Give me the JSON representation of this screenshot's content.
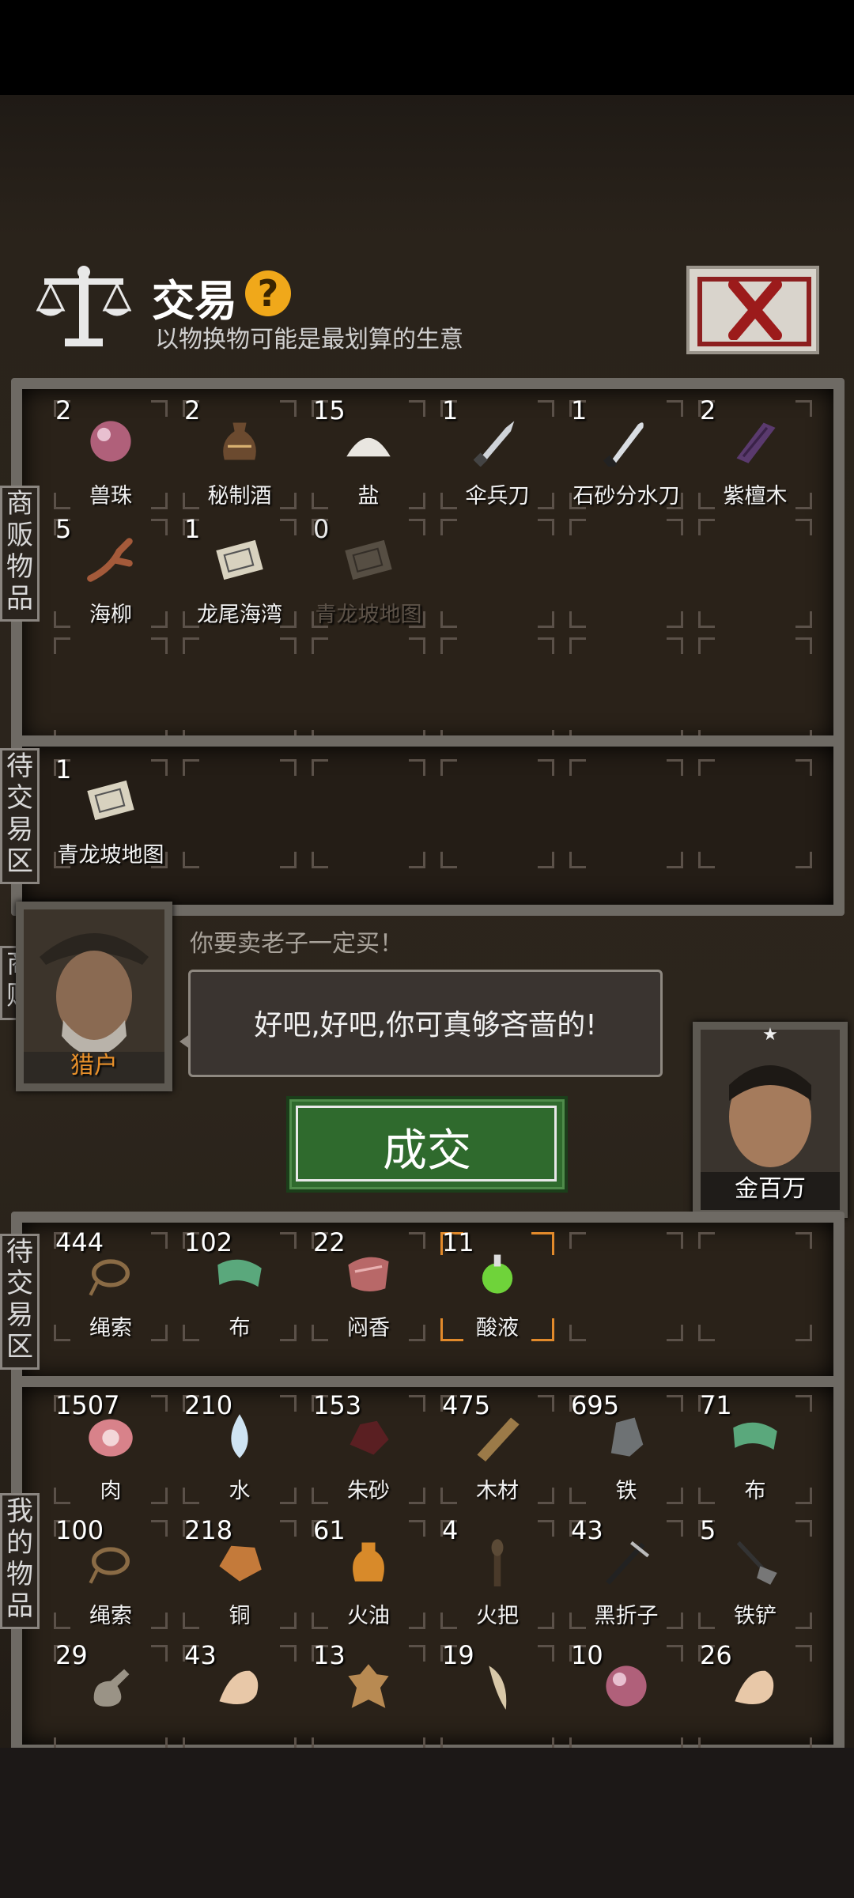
{
  "header": {
    "title": "交易",
    "subtitle": "以物换物可能是最划算的生意",
    "help_icon": "?"
  },
  "merchant_panel": {
    "side_label": "商贩物品",
    "items": [
      {
        "qty": "2",
        "name": "兽珠",
        "icon": "pearl-icon"
      },
      {
        "qty": "2",
        "name": "秘制酒",
        "icon": "wine-jar-icon"
      },
      {
        "qty": "15",
        "name": "盐",
        "icon": "salt-icon"
      },
      {
        "qty": "1",
        "name": "伞兵刀",
        "icon": "knife-icon"
      },
      {
        "qty": "1",
        "name": "石砂分水刀",
        "icon": "blade-icon"
      },
      {
        "qty": "2",
        "name": "紫檀木",
        "icon": "wood-icon"
      },
      {
        "qty": "5",
        "name": "海柳",
        "icon": "branch-icon"
      },
      {
        "qty": "1",
        "name": "龙尾海湾",
        "icon": "map-icon"
      },
      {
        "qty": "0",
        "name": "青龙坡地图",
        "icon": "map-icon"
      }
    ]
  },
  "merchant_pending": {
    "side_label": "待交易区",
    "items": [
      {
        "qty": "1",
        "name": "青龙坡地图",
        "icon": "map-icon"
      }
    ]
  },
  "dialogue": {
    "side_label": "商贩",
    "merchant_name": "猎户",
    "merchant_line": "你要卖老子一定买！",
    "bubble": "好吧,好吧,你可真够吝啬的!",
    "player_name": "金百万",
    "deal_button": "成交"
  },
  "player_pending": {
    "side_label": "待交易区",
    "items": [
      {
        "qty": "444",
        "name": "绳索",
        "icon": "rope-icon"
      },
      {
        "qty": "102",
        "name": "布",
        "icon": "cloth-icon"
      },
      {
        "qty": "22",
        "name": "闷香",
        "icon": "incense-icon"
      },
      {
        "qty": "11",
        "name": "酸液",
        "icon": "potion-icon"
      }
    ]
  },
  "player_items": {
    "side_label": "我的物品",
    "items": [
      {
        "qty": "1507",
        "name": "肉",
        "icon": "meat-icon"
      },
      {
        "qty": "210",
        "name": "水",
        "icon": "water-icon"
      },
      {
        "qty": "153",
        "name": "朱砂",
        "icon": "cinnabar-icon"
      },
      {
        "qty": "475",
        "name": "木材",
        "icon": "plank-icon"
      },
      {
        "qty": "695",
        "name": "铁",
        "icon": "iron-icon"
      },
      {
        "qty": "71",
        "name": "布",
        "icon": "cloth-icon"
      },
      {
        "qty": "100",
        "name": "绳索",
        "icon": "rope-icon"
      },
      {
        "qty": "218",
        "name": "铜",
        "icon": "copper-icon"
      },
      {
        "qty": "61",
        "name": "火油",
        "icon": "oil-icon"
      },
      {
        "qty": "4",
        "name": "火把",
        "icon": "torch-icon"
      },
      {
        "qty": "43",
        "name": "黑折子",
        "icon": "pick-icon"
      },
      {
        "qty": "5",
        "name": "铁铲",
        "icon": "shovel-icon"
      },
      {
        "qty": "29",
        "name": "",
        "icon": "flask-icon"
      },
      {
        "qty": "43",
        "name": "",
        "icon": "bone-icon"
      },
      {
        "qty": "13",
        "name": "",
        "icon": "hide-icon"
      },
      {
        "qty": "19",
        "name": "",
        "icon": "fang-icon"
      },
      {
        "qty": "10",
        "name": "",
        "icon": "pearl-icon"
      },
      {
        "qty": "26",
        "name": "",
        "icon": "bone-icon"
      }
    ]
  }
}
